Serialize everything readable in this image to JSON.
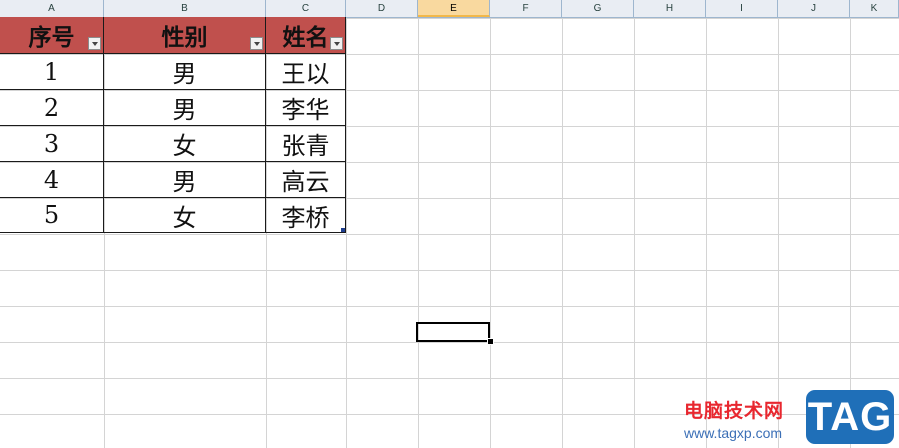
{
  "columns": [
    "A",
    "B",
    "C",
    "D",
    "E",
    "F",
    "G",
    "H",
    "I",
    "J",
    "K"
  ],
  "selected_column": "E",
  "table": {
    "headers": [
      "序号",
      "性别",
      "姓名"
    ],
    "rows": [
      [
        "1",
        "男",
        "王以"
      ],
      [
        "2",
        "男",
        "李华"
      ],
      [
        "3",
        "女",
        "张青"
      ],
      [
        "4",
        "男",
        "高云"
      ],
      [
        "5",
        "女",
        "李桥"
      ]
    ]
  },
  "header_color": "#c0504d",
  "watermark": {
    "site_name": "电脑技术网",
    "url": "www.tagxp.com",
    "badge": "TAG"
  }
}
